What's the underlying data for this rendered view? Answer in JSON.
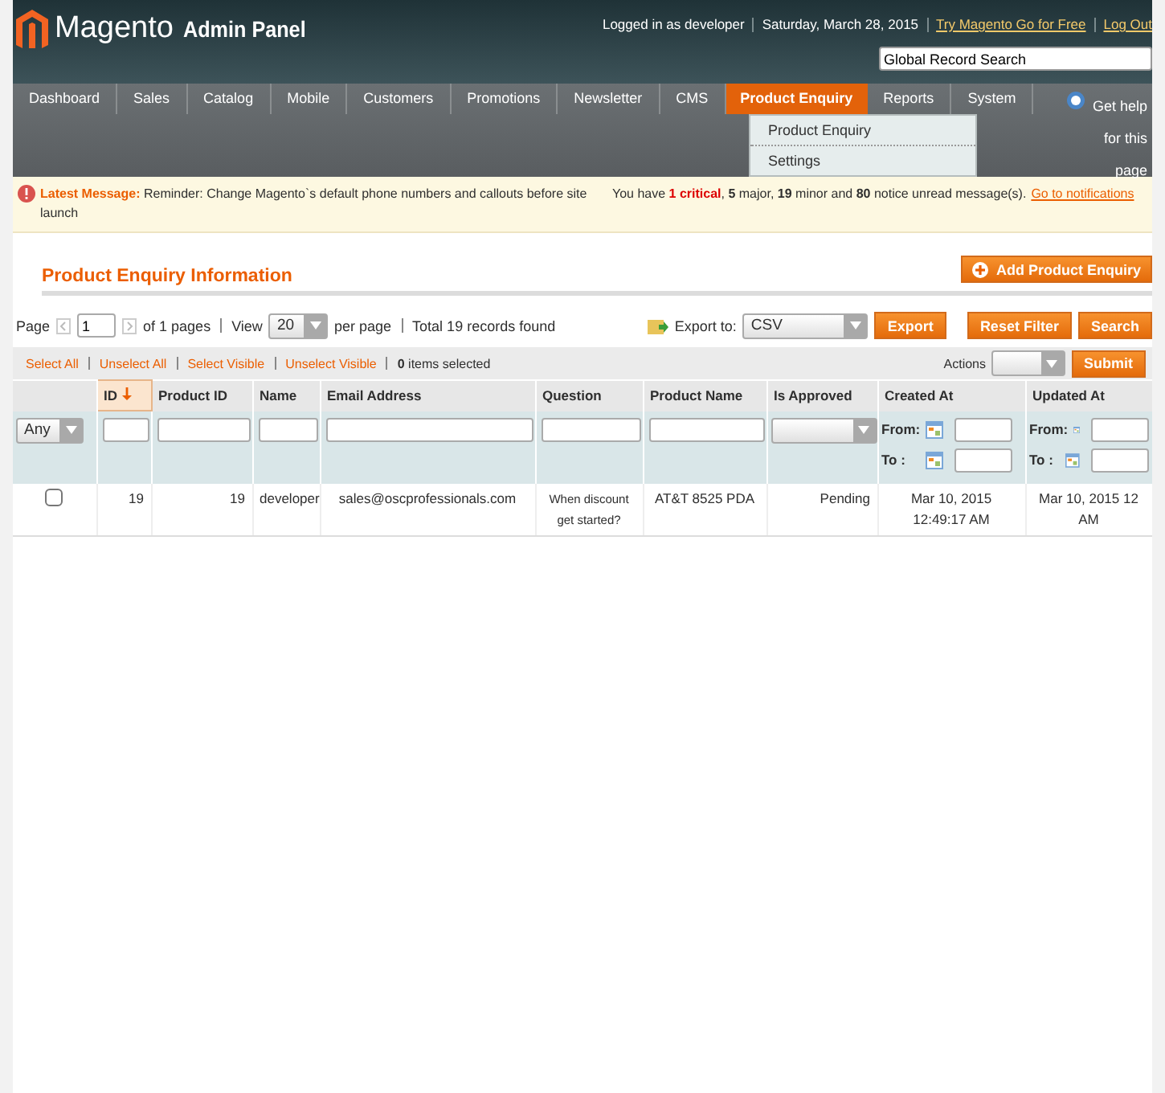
{
  "header": {
    "logo": "Magento",
    "subtitle": "Admin Panel",
    "user_info": "Logged in as developer",
    "date": "Saturday, March 28, 2015",
    "links": [
      "Try Magento Go for Free",
      "Log Out"
    ],
    "search": {
      "value": "Global Record Search"
    }
  },
  "nav": {
    "items": [
      {
        "label": "Dashboard",
        "selected": false
      },
      {
        "label": "Sales",
        "selected": false
      },
      {
        "label": "Catalog",
        "selected": false
      },
      {
        "label": "Mobile",
        "selected": false
      },
      {
        "label": "Customers",
        "selected": false
      },
      {
        "label": "Promotions",
        "selected": false
      },
      {
        "label": "Newsletter",
        "selected": false
      },
      {
        "label": "CMS",
        "selected": false
      },
      {
        "label": "Product Enquiry",
        "selected": true
      },
      {
        "label": "Reports",
        "selected": false
      },
      {
        "label": "System",
        "selected": false
      }
    ],
    "help": "Get help for this page",
    "dropdown": [
      "Product Enquiry",
      "Settings"
    ]
  },
  "message": {
    "label": "Latest Message:",
    "text": "Reminder: Change Magento`s default phone numbers and callouts before site launch",
    "notice_prefix": "You have ",
    "critical": "1 critical",
    "notice_rest": ", **5** major, **19** minor and **80** notice unread message(s).",
    "link": "Go to notifications"
  },
  "title": "Product Enquiry Information",
  "add_button": "Add Product Enquiry",
  "pager": {
    "page_label": "Page",
    "page": "1",
    "of_pages": "of 1 pages",
    "view_label": "View",
    "per_page": "20",
    "per_page_label": "per page",
    "total": "Total 19 records found",
    "export_label": "Export to:",
    "export_format": "CSV",
    "buttons": [
      "Export",
      "Reset Filter",
      "Search"
    ]
  },
  "massaction": {
    "links": [
      "Select All",
      "Unselect All",
      "Select Visible",
      "Unselect Visible"
    ],
    "selected_count": "**0** items selected",
    "actions_label": "Actions",
    "submit": "Submit"
  },
  "table": {
    "columns": [
      {
        "label": "ID",
        "sorted": true
      },
      {
        "label": "Product ID",
        "sorted": false
      },
      {
        "label": "Name",
        "sorted": false
      },
      {
        "label": "Email Address",
        "sorted": false
      },
      {
        "label": "Question",
        "sorted": false
      },
      {
        "label": "Product Name",
        "sorted": false
      },
      {
        "label": "Is Approved",
        "sorted": false
      },
      {
        "label": "Created At",
        "sorted": false
      },
      {
        "label": "Updated At",
        "sorted": false
      }
    ],
    "filter": {
      "any": "Any",
      "dates": [
        {
          "from": "From:",
          "to": "To :"
        },
        {
          "from": "From:",
          "to": "To :"
        }
      ]
    },
    "rows": [
      {
        "checked": false,
        "id": "19",
        "product_id": "19",
        "name": "developer",
        "email": "sales@oscprofessionals.com",
        "question": "When discount get started?",
        "product_name": "AT&T 8525 PDA",
        "approved": "Pending",
        "created_at": "Mar 10, 2015 12:49:17 AM",
        "updated_at": [
          "Mar 10, 2015 12",
          "AM"
        ]
      }
    ]
  }
}
